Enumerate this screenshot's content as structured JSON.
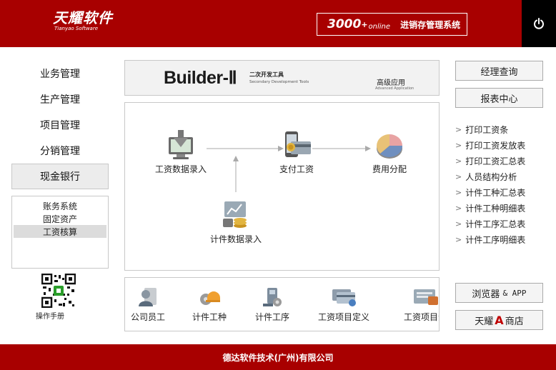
{
  "header": {
    "logo_main": "天耀软件",
    "logo_sub": "Tianyao Software",
    "product_version": "3000",
    "product_plus": "+",
    "product_online": "online",
    "product_name": "进销存管理系统"
  },
  "nav": {
    "items": [
      {
        "label": "业务管理"
      },
      {
        "label": "生产管理"
      },
      {
        "label": "项目管理"
      },
      {
        "label": "分销管理"
      },
      {
        "label": "现金银行",
        "active": true
      }
    ],
    "sub_items": [
      {
        "label": "账务系统"
      },
      {
        "label": "固定资产"
      },
      {
        "label": "工资核算",
        "active": true
      }
    ],
    "manual_label": "操作手册"
  },
  "banner": {
    "title": "Builder-Ⅱ",
    "subtitle_zh": "二次开发工具",
    "subtitle_en": "Secondary Development Tools",
    "advanced": "高级应用",
    "advanced_en": "Advanced Application"
  },
  "flow": {
    "nodes": [
      {
        "label": "工资数据录入"
      },
      {
        "label": "支付工资"
      },
      {
        "label": "费用分配"
      },
      {
        "label": "计件数据录入"
      }
    ]
  },
  "toolbar": {
    "items": [
      {
        "label": "公司员工"
      },
      {
        "label": "计件工种"
      },
      {
        "label": "计件工序"
      },
      {
        "label": "工资项目定义"
      },
      {
        "label": "工资项目分"
      }
    ]
  },
  "right": {
    "manager_query": "经理查询",
    "report_center": "报表中心",
    "reports": [
      "打印工资条",
      "打印工资发放表",
      "打印工资汇总表",
      "人员结构分析",
      "计件工种汇总表",
      "计件工种明细表",
      "计件工序汇总表",
      "计件工序明细表"
    ],
    "browser_label": "浏览器",
    "browser_amp": "& APP",
    "shop_pre": "天耀",
    "shop_a": "A",
    "shop_post": "商店"
  },
  "footer": {
    "company": "德达软件技术(广州)有限公司"
  },
  "colors": {
    "brand_red": "#a80000",
    "accent_red": "#c00000"
  }
}
